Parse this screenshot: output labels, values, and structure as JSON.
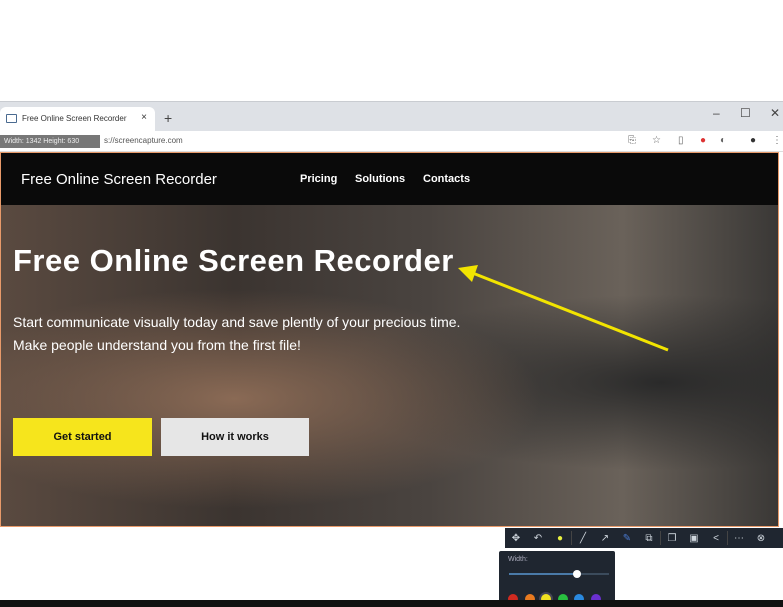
{
  "browser": {
    "tab_title": "Free Online Screen Recorder",
    "close": "×",
    "new_tab": "+",
    "minimize": "–",
    "maximize": "☐",
    "close_window": "✕",
    "dimensions": "Width: 1342 Height: 630",
    "url": "s://screencapture.com"
  },
  "site": {
    "brand": "Free Online Screen Recorder",
    "nav": [
      "Pricing",
      "Solutions",
      "Contacts"
    ],
    "hero_title": "Free Online Screen Recorder",
    "hero_sub1": "Start communicate visually today and save plently of your precious time.",
    "hero_sub2": "Make people understand you from the first file!",
    "cta_primary": "Get started",
    "cta_secondary": "How it works"
  },
  "toolbar": {
    "icons": [
      "move-icon",
      "undo-icon",
      "color-icon",
      "line-icon",
      "arrow-icon",
      "marker-icon",
      "shape-icon",
      "copy-icon",
      "save-icon",
      "share-icon",
      "more-icon",
      "close-icon"
    ],
    "popup_label": "Width:",
    "width_value_pct": 68,
    "colors": [
      "#d02a20",
      "#e87a20",
      "#f0e020",
      "#28c040",
      "#2a8ae0",
      "#6a30d0"
    ],
    "selected_color": "#f0e020"
  },
  "colors": {
    "accent": "#f6e51c",
    "annotation": "#f2e400"
  }
}
